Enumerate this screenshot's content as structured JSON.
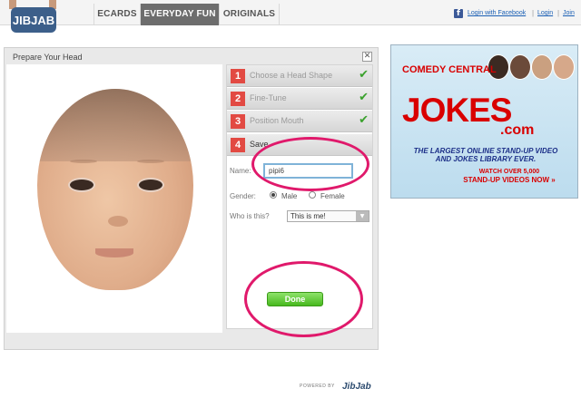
{
  "site": {
    "logo_text": "JIBJAB"
  },
  "nav": {
    "tabs": [
      {
        "label": "ECARDS",
        "active": false
      },
      {
        "label": "EVERYDAY FUN",
        "active": true
      },
      {
        "label": "ORIGINALS",
        "active": false
      }
    ],
    "facebook_icon": "f",
    "facebook_link": "Login with Facebook",
    "separator": "|",
    "login": "Login",
    "join": "Join"
  },
  "dialog": {
    "title": "Prepare Your Head",
    "close_symbol": "✕",
    "steps": [
      {
        "number": "1",
        "label": "Choose a Head Shape",
        "completed": true
      },
      {
        "number": "2",
        "label": "Fine-Tune",
        "completed": true
      },
      {
        "number": "3",
        "label": "Position Mouth",
        "completed": true
      },
      {
        "number": "4",
        "label": "Save",
        "completed": false
      }
    ],
    "check_symbol": "✔",
    "form": {
      "name_label": "Name:",
      "name_value": "pipi6",
      "gender_label": "Gender:",
      "gender_options": [
        {
          "label": "Male",
          "selected": true
        },
        {
          "label": "Female",
          "selected": false
        }
      ],
      "who_label": "Who is this?",
      "who_value": "This is me!",
      "dropdown_arrow": "▼"
    },
    "done_button": "Done",
    "powered_by": "POWERED BY",
    "powered_logo": "JibJab"
  },
  "ad": {
    "brand": "COMEDY CENTRAL",
    "headline": "JOKES",
    "headline_suffix": ".com",
    "tagline_1": "THE LARGEST ONLINE STAND-UP VIDEO",
    "tagline_2": "AND JOKES LIBRARY EVER.",
    "cta_1": "WATCH OVER 5,000",
    "cta_2": "STAND-UP VIDEOS NOW »"
  },
  "colors": {
    "accent_red": "#e24a43",
    "check_green": "#3aa12c",
    "done_green": "#47b81e",
    "annotation_pink": "#e0196b",
    "active_tab": "#6d6d6d"
  },
  "icons": [
    "close-icon",
    "checkmark-icon",
    "facebook-icon",
    "dropdown-arrow-icon"
  ]
}
